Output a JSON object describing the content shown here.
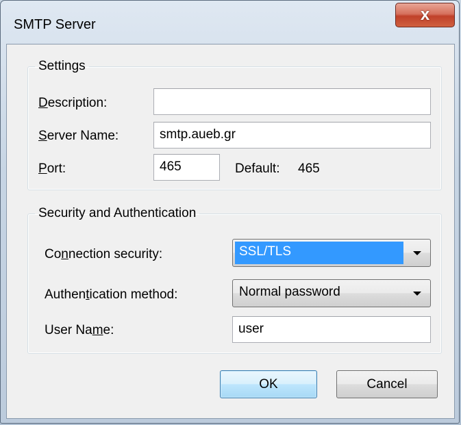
{
  "window": {
    "title": "SMTP Server",
    "close_glyph": "x"
  },
  "settings": {
    "legend": "Settings",
    "description": {
      "label_hotkey": "D",
      "label_rest": "escription:",
      "value": ""
    },
    "server_name": {
      "label_hotkey": "S",
      "label_rest": "erver Name:",
      "value": "smtp.aueb.gr"
    },
    "port": {
      "label_hotkey": "P",
      "label_rest": "ort:",
      "value": "465"
    },
    "default_label": "Default:",
    "default_value": "465"
  },
  "security": {
    "legend": "Security and Authentication",
    "connection": {
      "label_pre": "Co",
      "label_hotkey": "n",
      "label_post": "nection security:",
      "value": "SSL/TLS"
    },
    "auth": {
      "label_pre": "Authen",
      "label_hotkey": "t",
      "label_post": "ication method:",
      "value": "Normal password"
    },
    "username": {
      "label_pre": "User Na",
      "label_hotkey": "m",
      "label_post": "e:",
      "value": "user"
    }
  },
  "buttons": {
    "ok": "OK",
    "cancel": "Cancel"
  },
  "colors": {
    "selection": "#3399ff",
    "close_red": "#c0412a"
  },
  "icons": {
    "dropdown": "chevron-down-icon",
    "close": "close-icon"
  }
}
